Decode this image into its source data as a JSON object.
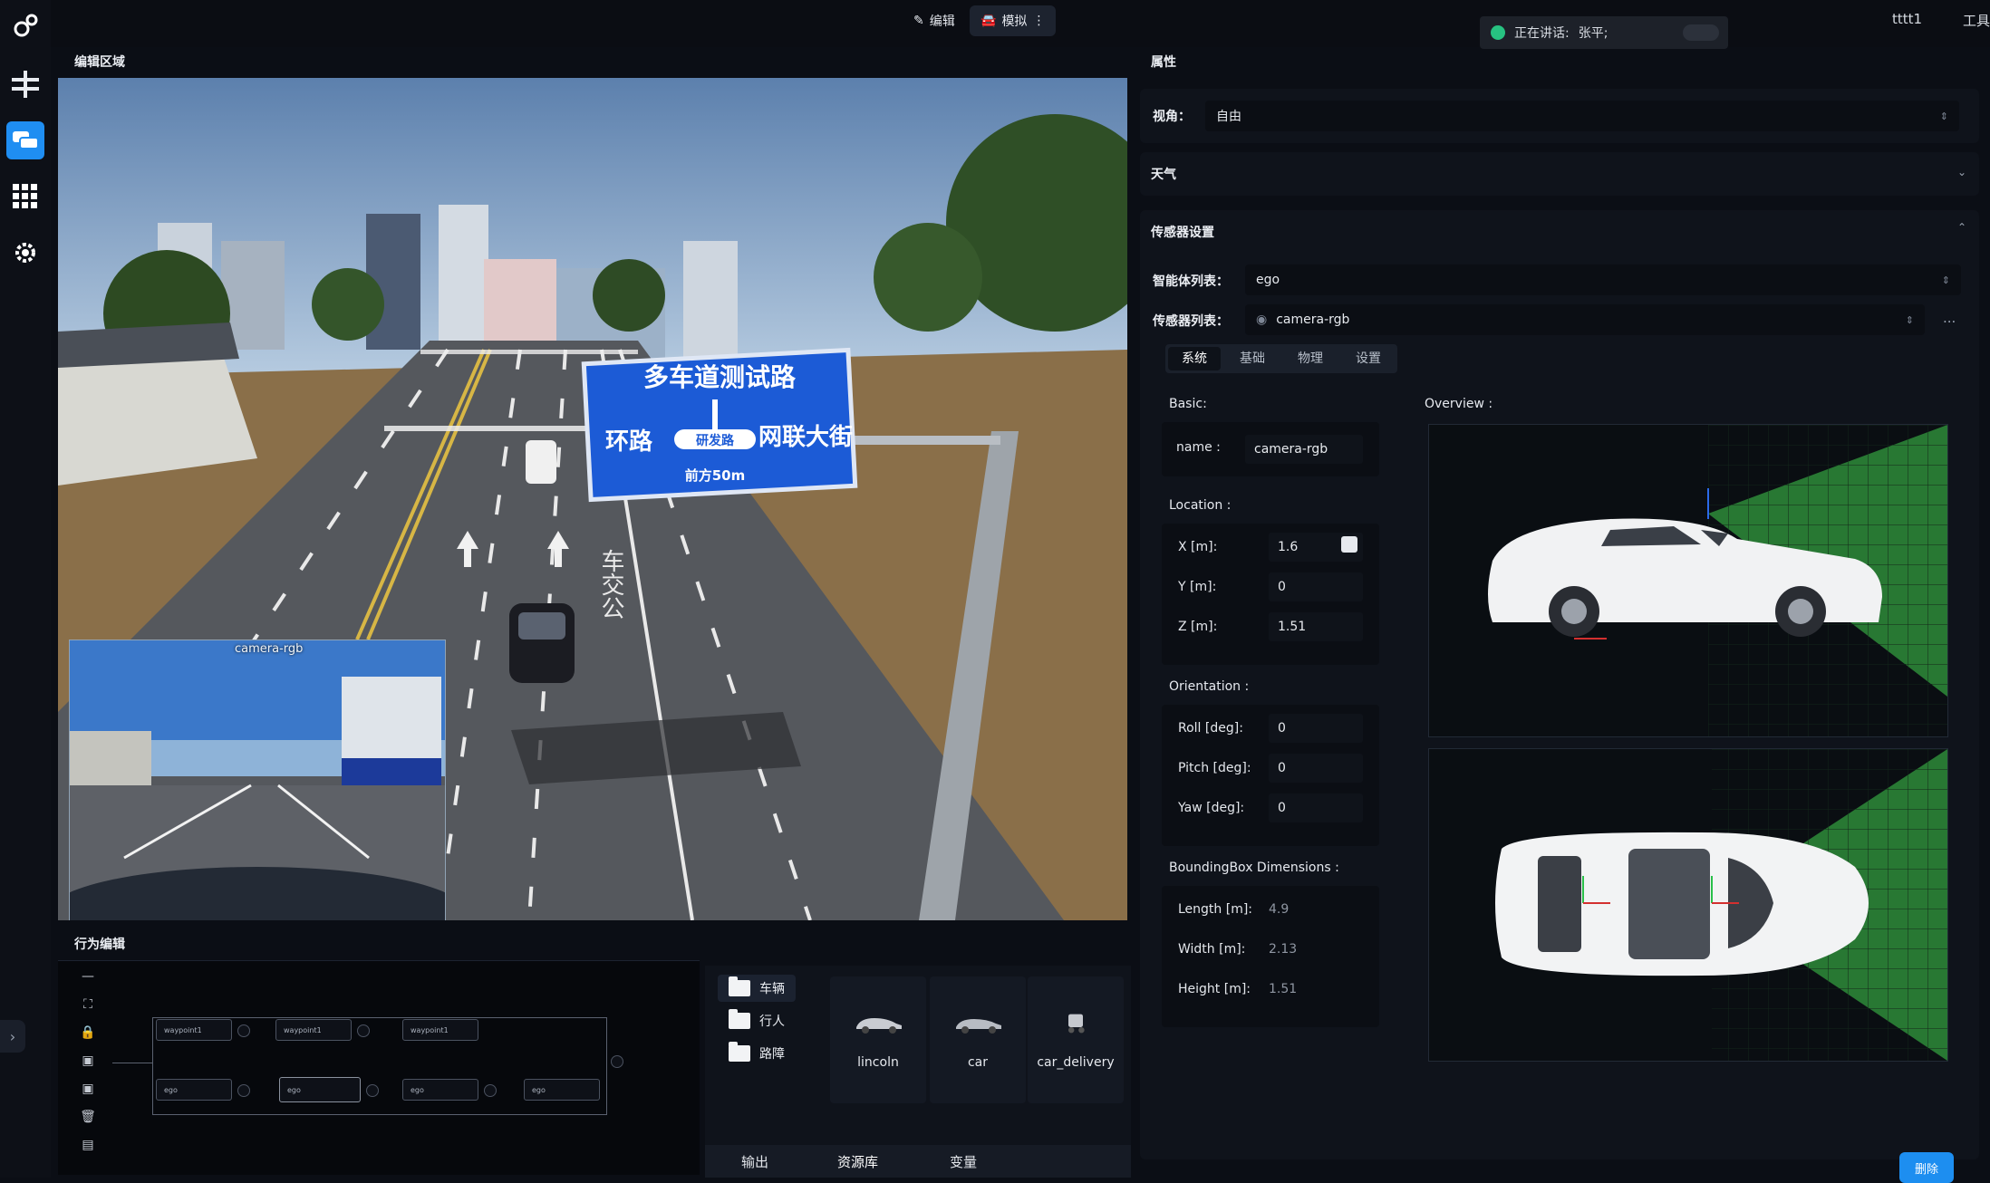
{
  "topbar": {
    "edit_label": "编辑",
    "simulate_label": "模拟",
    "speaking_prefix": "正在讲话:",
    "speaking_name": "张平;",
    "user_name": "tttt1",
    "tools_label": "工具"
  },
  "nav": {
    "items": [
      "gears-icon",
      "road-junction-icon",
      "vehicles-icon",
      "grid-icon",
      "gear-icon"
    ],
    "active": "vehicles-icon"
  },
  "editor": {
    "title": "编辑区域",
    "sign_title": "多车道测试路",
    "sign_left": "环路",
    "sign_center": "研发路",
    "sign_right": "网联大街",
    "sign_bottom": "前方50m",
    "road_text": "车交公",
    "camera_inset_label": "camera-rgb"
  },
  "behavior": {
    "title": "行为编辑",
    "tools": [
      "minus-icon",
      "fit-view-icon",
      "lock-icon",
      "camera-icon",
      "camera-icon",
      "trash-icon",
      "save-icon"
    ],
    "nodes_top": [
      "waypoint1",
      "waypoint1",
      "waypoint1"
    ],
    "nodes_bottom": [
      "ego",
      "ego",
      "ego",
      "ego"
    ]
  },
  "assets": {
    "folders": [
      "车辆",
      "行人",
      "路障"
    ],
    "active_folder": "车辆",
    "items": [
      "lincoln",
      "car",
      "car_delivery"
    ],
    "tabs": [
      "输出",
      "资源库",
      "变量"
    ],
    "active_tab": "资源库"
  },
  "props": {
    "title": "属性",
    "view_label": "视角：",
    "view_value": "自由",
    "weather_title": "天气",
    "sensor_title": "传感器设置",
    "agent_list_label": "智能体列表：",
    "agent_value": "ego",
    "sensor_list_label": "传感器列表：",
    "sensor_value": "camera-rgb",
    "more_label": "...",
    "subtabs": [
      "系统",
      "基础",
      "物理",
      "设置"
    ],
    "active_subtab": "系统",
    "basic_title": "Basic:",
    "name_label": "name :",
    "name_value": "camera-rgb",
    "location_title": "Location :",
    "x_label": "X [m]:",
    "x_value": "1.6",
    "y_label": "Y [m]:",
    "y_value": "0",
    "z_label": "Z [m]:",
    "z_value": "1.51",
    "orientation_title": "Orientation :",
    "roll_label": "Roll [deg]:",
    "roll_value": "0",
    "pitch_label": "Pitch [deg]:",
    "pitch_value": "0",
    "yaw_label": "Yaw [deg]:",
    "yaw_value": "0",
    "bbox_title": "BoundingBox Dimensions :",
    "length_label": "Length [m]:",
    "length_value": "4.9",
    "width_label": "Width [m]:",
    "width_value": "2.13",
    "height_label": "Height [m]:",
    "height_value": "1.51",
    "overview_title": "Overview :",
    "delete_label": "删除"
  },
  "colors": {
    "accent": "#1f8ef2",
    "fov_green": "#2e8b3a",
    "sign_blue": "#1c5bd6"
  }
}
